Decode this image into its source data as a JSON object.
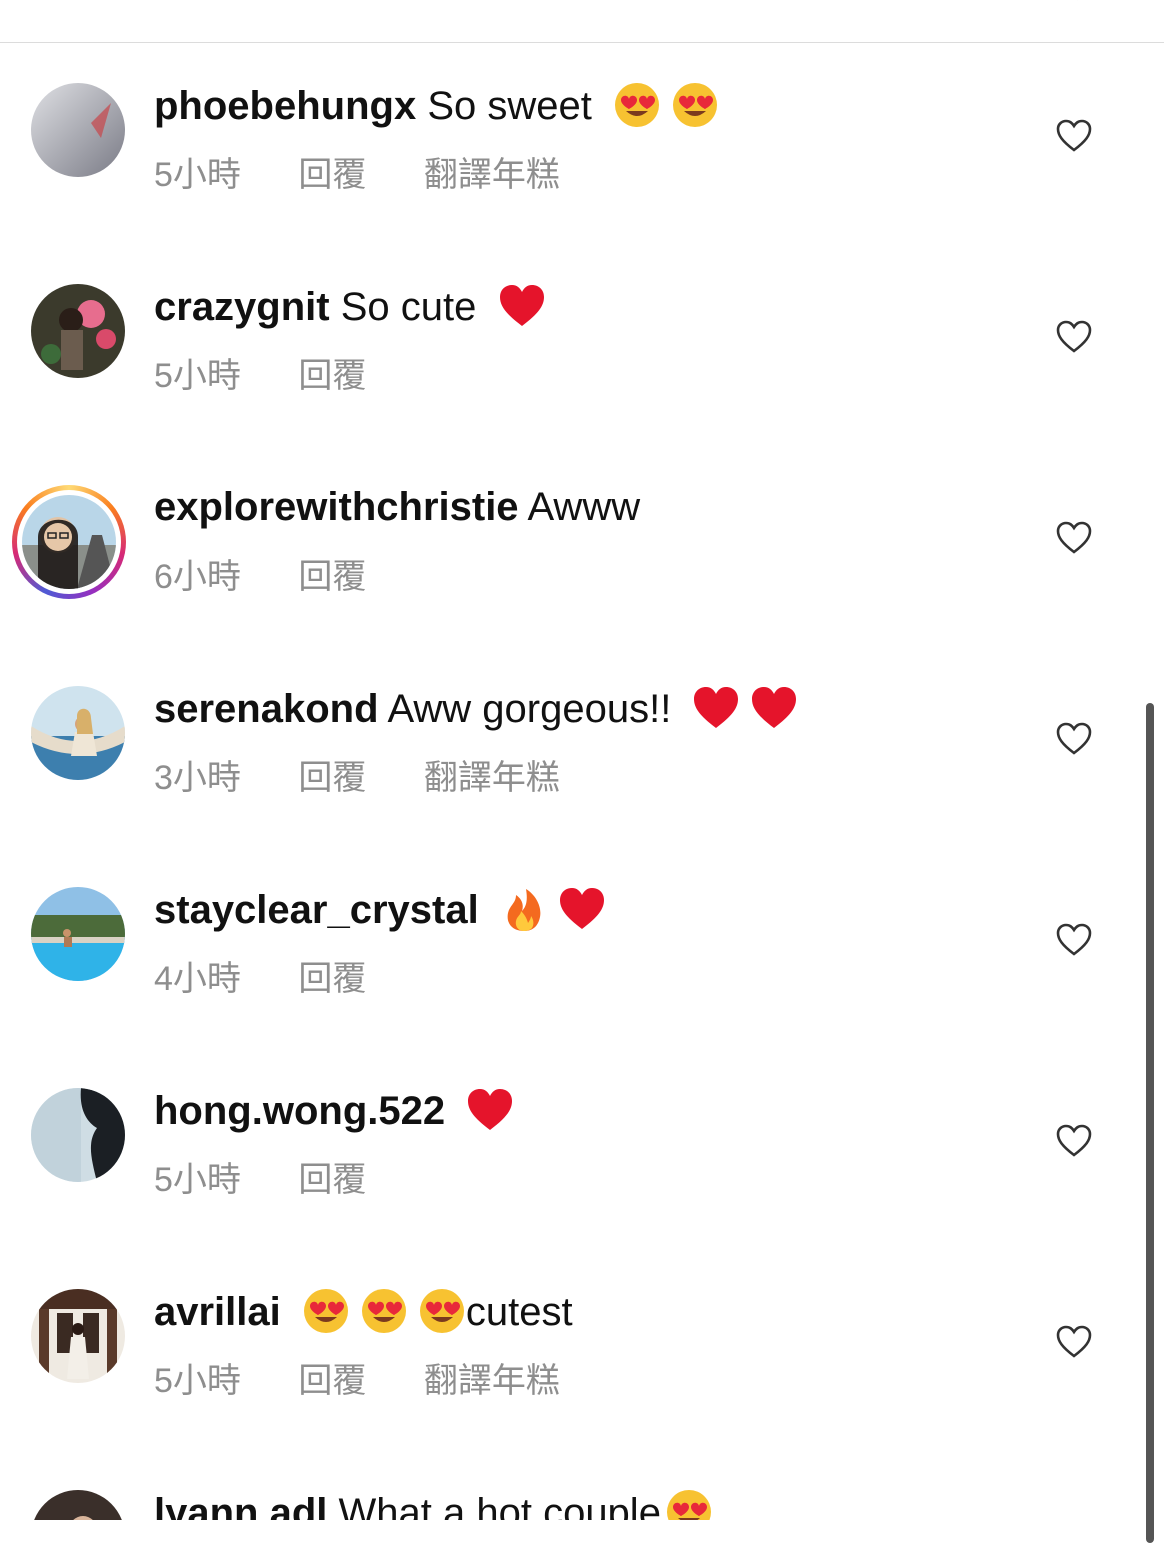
{
  "comments": [
    {
      "username": "phoebehungx",
      "text": "So sweet",
      "emojis": [
        "heart-eyes",
        "heart-eyes"
      ],
      "emoji_position": "after",
      "time": "5小時",
      "reply": "回覆",
      "translate": "翻譯年糕"
    },
    {
      "username": "crazygnit",
      "text": "So cute",
      "emojis": [
        "red-heart"
      ],
      "emoji_position": "after",
      "time": "5小時",
      "reply": "回覆",
      "translate": ""
    },
    {
      "username": "explorewithchristie",
      "text": "Awww",
      "emojis": [],
      "emoji_position": "after",
      "time": "6小時",
      "reply": "回覆",
      "translate": ""
    },
    {
      "username": "serenakond",
      "text": "Aww gorgeous!!",
      "emojis": [
        "red-heart",
        "red-heart"
      ],
      "emoji_position": "after",
      "time": "3小時",
      "reply": "回覆",
      "translate": "翻譯年糕"
    },
    {
      "username": "stayclear_crystal",
      "text": "",
      "emojis": [
        "fire",
        "red-heart"
      ],
      "emoji_position": "after",
      "time": "4小時",
      "reply": "回覆",
      "translate": ""
    },
    {
      "username": "hong.wong.522",
      "text": "",
      "emojis": [
        "red-heart"
      ],
      "emoji_position": "after",
      "time": "5小時",
      "reply": "回覆",
      "translate": ""
    },
    {
      "username": "avrillai",
      "text": "cutest",
      "emojis": [
        "heart-eyes",
        "heart-eyes",
        "heart-eyes"
      ],
      "emoji_position": "before",
      "time": "5小時",
      "reply": "回覆",
      "translate": "翻譯年糕"
    },
    {
      "username": "lyann.adl",
      "text": "What a hot couple",
      "emojis": [
        "heart-eyes"
      ],
      "emoji_position": "after",
      "time": "",
      "reply": "",
      "translate": ""
    }
  ]
}
